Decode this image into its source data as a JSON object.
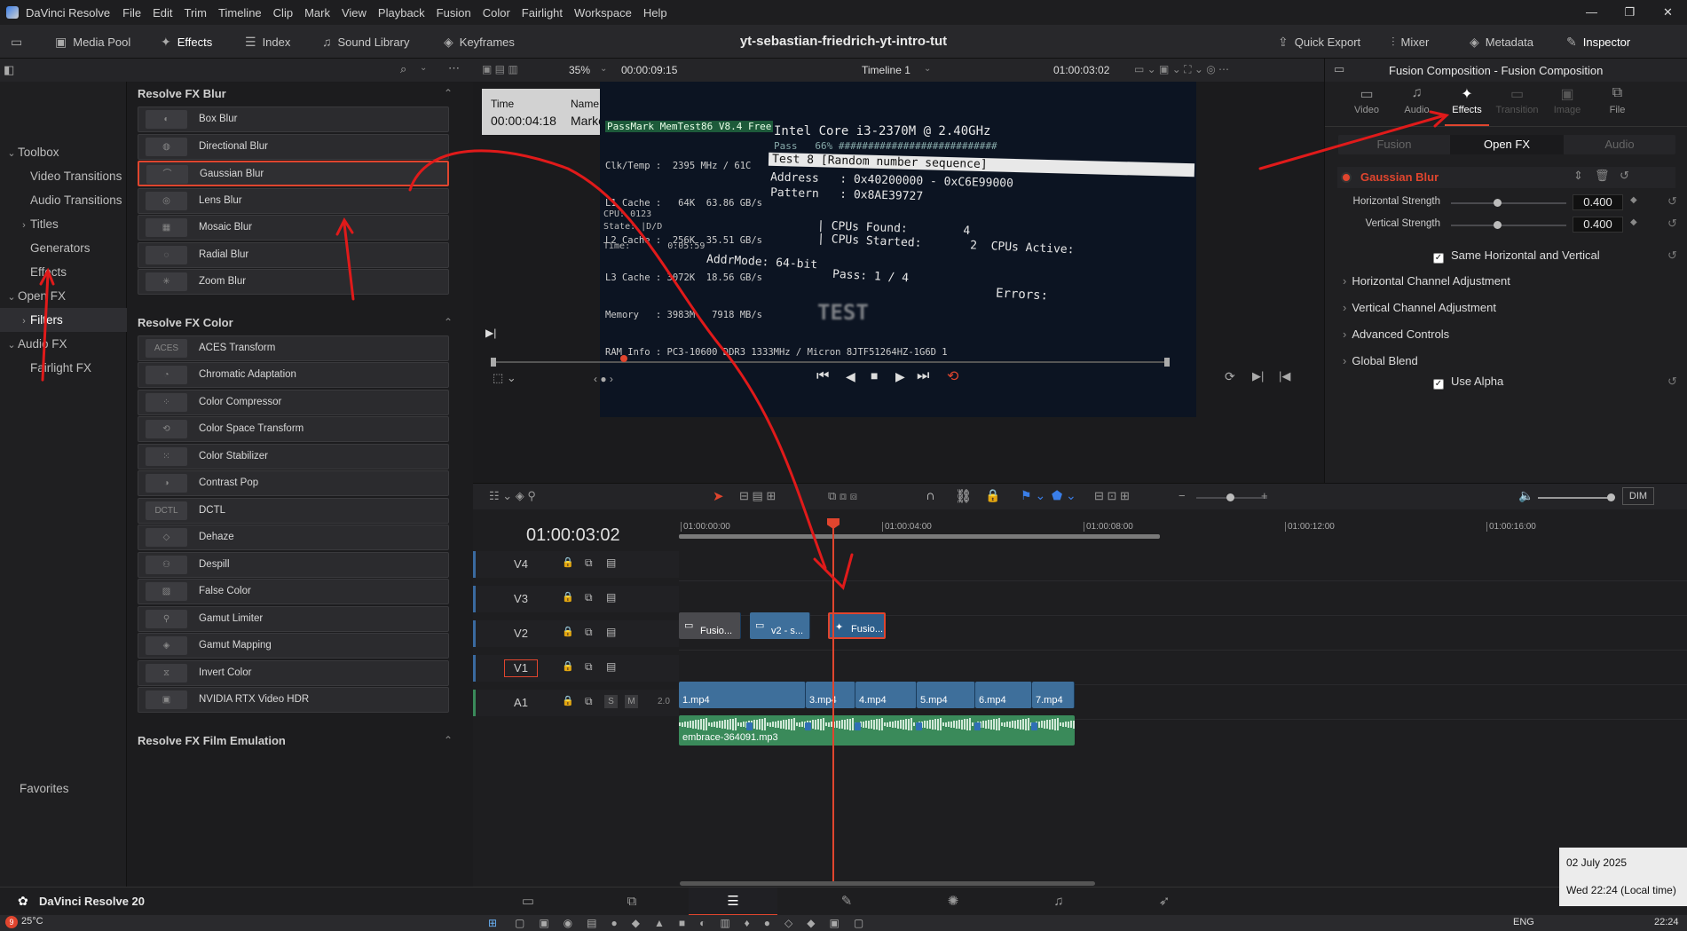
{
  "menubar": {
    "app_name": "DaVinci Resolve",
    "items": [
      "File",
      "Edit",
      "Trim",
      "Timeline",
      "Clip",
      "Mark",
      "View",
      "Playback",
      "Fusion",
      "Color",
      "Fairlight",
      "Workspace",
      "Help"
    ],
    "win_controls": [
      "—",
      "❐",
      "✕"
    ]
  },
  "toolbar": {
    "media_pool": "Media Pool",
    "effects": "Effects",
    "index": "Index",
    "sound_library": "Sound Library",
    "keyframes": "Keyframes",
    "project_title": "yt-sebastian-friedrich-yt-intro-tut",
    "quick_export": "Quick Export",
    "mixer": "Mixer",
    "metadata": "Metadata",
    "inspector": "Inspector"
  },
  "left_panel": {
    "items": [
      {
        "label": "Toolbox",
        "caret": "⌄",
        "indent": 0
      },
      {
        "label": "Video Transitions",
        "caret": "",
        "indent": 1
      },
      {
        "label": "Audio Transitions",
        "caret": "",
        "indent": 1
      },
      {
        "label": "Titles",
        "caret": "›",
        "indent": 1
      },
      {
        "label": "Generators",
        "caret": "",
        "indent": 1
      },
      {
        "label": "Effects",
        "caret": "",
        "indent": 1
      },
      {
        "label": "Open FX",
        "caret": "⌄",
        "indent": 0
      },
      {
        "label": "Filters",
        "caret": "›",
        "indent": 1
      },
      {
        "label": "Audio FX",
        "caret": "⌄",
        "indent": 0
      },
      {
        "label": "Fairlight FX",
        "caret": "",
        "indent": 1
      }
    ],
    "favorites": "Favorites"
  },
  "fx_panel": {
    "sections": [
      {
        "title": "Resolve FX Blur",
        "items": [
          "Box Blur",
          "Directional Blur",
          "Gaussian Blur",
          "Lens Blur",
          "Mosaic Blur",
          "Radial Blur",
          "Zoom Blur"
        ]
      },
      {
        "title": "Resolve FX Color",
        "items": [
          "ACES Transform",
          "Chromatic Adaptation",
          "Color Compressor",
          "Color Space Transform",
          "Color Stabilizer",
          "Contrast Pop",
          "DCTL",
          "Dehaze",
          "Despill",
          "False Color",
          "Gamut Limiter",
          "Gamut Mapping",
          "Invert Color",
          "NVIDIA RTX Video HDR"
        ]
      },
      {
        "title": "Resolve FX Film Emulation",
        "items": []
      }
    ],
    "aces_thumb": "ACES",
    "dctl_thumb": "DCTL"
  },
  "viewer": {
    "zoom": "35%",
    "source_tc": "00:00:09:15",
    "timeline_name": "Timeline 1",
    "record_tc": "01:00:03:02",
    "marker": {
      "time_label": "Time",
      "time": "00:00:04:18",
      "name_label": "Name",
      "name": "Marker 2"
    },
    "frame_text": {
      "header": "PassMark MemTest86 V8.4 Free",
      "cpu": "Intel Core i3-2370M @ 2.40GHz",
      "lines_left": [
        "Clk/Temp :  2395 MHz / 61C",
        "L1 Cache :   64K  63.86 GB/s",
        "L2 Cache :  256K  35.51 GB/s",
        "L3 Cache : 3072K  18.56 GB/s",
        "Memory   : 3983M   7918 MB/s",
        "RAM Info : PC3-10600 DDR3 1333MHz / Micron 8JTF51264HZ-1G6D 1"
      ],
      "pass_line": "Pass   66% ###########################",
      "test": "Test 8 [Random number sequence]",
      "address": "Address   : 0x40200000 - 0xC6E99000",
      "pattern": "Pattern   : 0x8AE39727",
      "cpu_label": "CPU:  0123",
      "state_label": "State: |D/D",
      "cpus_found": "| CPUs Found:        4",
      "cpus_started": "| CPUs Started:       2  CPUs Active:",
      "time": "Time:       0:05:59",
      "addrmode": "AddrMode: 64-bit",
      "pass": "Pass: 1 / 4",
      "errors": "Errors:",
      "watermark": "TEST"
    }
  },
  "inspector": {
    "title": "Fusion Composition - Fusion Composition",
    "tabs": [
      "Video",
      "Audio",
      "Effects",
      "Transition",
      "Image",
      "File"
    ],
    "subtabs": [
      "Fusion",
      "Open FX",
      "Audio"
    ],
    "effect_name": "Gaussian Blur",
    "params": [
      {
        "label": "Horizontal Strength",
        "value": "0.400",
        "level": 0.4
      },
      {
        "label": "Vertical Strength",
        "value": "0.400",
        "level": 0.4
      }
    ],
    "same_hv": "Same Horizontal and Vertical",
    "groups": [
      "Horizontal Channel Adjustment",
      "Vertical Channel Adjustment",
      "Advanced Controls",
      "Global Blend"
    ],
    "use_alpha": "Use Alpha"
  },
  "timeline": {
    "timecode": "01:00:03:02",
    "ruler": [
      "01:00:00:00",
      "01:00:04:00",
      "01:00:08:00",
      "01:00:12:00",
      "01:00:16:00"
    ],
    "tracks": [
      "V4",
      "V3",
      "V2",
      "V1",
      "A1"
    ],
    "audio_level": "2.0",
    "solo": "S",
    "mute": "M",
    "dim": "DIM",
    "v3_clips": [
      "Fusio...",
      "v2 - s...",
      "Fusio..."
    ],
    "v1_clips": [
      "1.mp4",
      "3.mp4",
      "4.mp4",
      "5.mp4",
      "6.mp4",
      "7.mp4"
    ],
    "a1_clip": "embrace-364091.mp3"
  },
  "bottom": {
    "app_version": "DaVinci Resolve 20",
    "date_tip": "02 July 2025",
    "time_tip": "Wed 22:24 (Local time)",
    "weather": "25°C",
    "lang": "ENG",
    "clock": "22:24",
    "notif": "9"
  },
  "colors": {
    "accent": "#e0452e",
    "clip_blue": "#3e6f9b",
    "audio_green": "#3a8a5a",
    "playhead": "#e0452e"
  }
}
